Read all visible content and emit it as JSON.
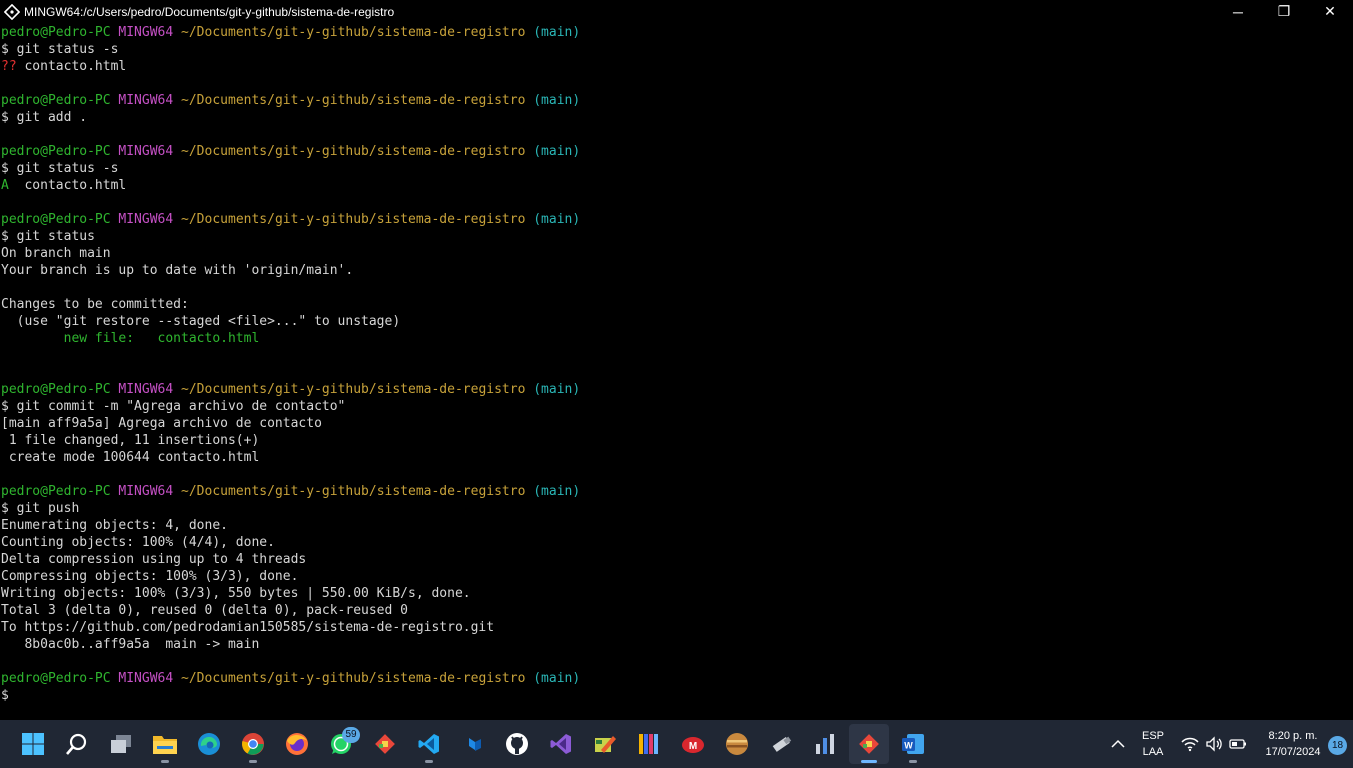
{
  "window": {
    "title": "MINGW64:/c/Users/pedro/Documents/git-y-github/sistema-de-registro",
    "minimize": "─",
    "restore": "❐",
    "close": "✕"
  },
  "prompt": {
    "user": "pedro@Pedro-PC",
    "sys": "MINGW64",
    "path": "~/Documents/git-y-github/sistema-de-registro",
    "branch": "(main)",
    "symbol": "$"
  },
  "terminal": {
    "lines": [
      {
        "type": "prompt"
      },
      {
        "type": "cmd",
        "text": "$ git status -s"
      },
      {
        "type": "status_untracked",
        "mark": "??",
        "text": " contacto.html"
      },
      {
        "type": "blank"
      },
      {
        "type": "prompt"
      },
      {
        "type": "cmd",
        "text": "$ git add ."
      },
      {
        "type": "blank"
      },
      {
        "type": "prompt"
      },
      {
        "type": "cmd",
        "text": "$ git status -s"
      },
      {
        "type": "status_added",
        "mark": "A",
        "text": "  contacto.html"
      },
      {
        "type": "blank"
      },
      {
        "type": "prompt"
      },
      {
        "type": "cmd",
        "text": "$ git status"
      },
      {
        "type": "out",
        "text": "On branch main"
      },
      {
        "type": "out",
        "text": "Your branch is up to date with 'origin/main'."
      },
      {
        "type": "blank"
      },
      {
        "type": "out",
        "text": "Changes to be committed:"
      },
      {
        "type": "out",
        "text": "  (use \"git restore --staged <file>...\" to unstage)"
      },
      {
        "type": "green",
        "text": "        new file:   contacto.html"
      },
      {
        "type": "blank"
      },
      {
        "type": "blank"
      },
      {
        "type": "prompt"
      },
      {
        "type": "cmd",
        "text": "$ git commit -m \"Agrega archivo de contacto\""
      },
      {
        "type": "out",
        "text": "[main aff9a5a] Agrega archivo de contacto"
      },
      {
        "type": "out",
        "text": " 1 file changed, 11 insertions(+)"
      },
      {
        "type": "out",
        "text": " create mode 100644 contacto.html"
      },
      {
        "type": "blank"
      },
      {
        "type": "prompt"
      },
      {
        "type": "cmd",
        "text": "$ git push"
      },
      {
        "type": "out",
        "text": "Enumerating objects: 4, done."
      },
      {
        "type": "out",
        "text": "Counting objects: 100% (4/4), done."
      },
      {
        "type": "out",
        "text": "Delta compression using up to 4 threads"
      },
      {
        "type": "out",
        "text": "Compressing objects: 100% (3/3), done."
      },
      {
        "type": "out",
        "text": "Writing objects: 100% (3/3), 550 bytes | 550.00 KiB/s, done."
      },
      {
        "type": "out",
        "text": "Total 3 (delta 0), reused 0 (delta 0), pack-reused 0"
      },
      {
        "type": "out",
        "text": "To https://github.com/pedrodamian150585/sistema-de-registro.git"
      },
      {
        "type": "out",
        "text": "   8b0ac0b..aff9a5a  main -> main"
      },
      {
        "type": "blank"
      },
      {
        "type": "prompt"
      },
      {
        "type": "cmd",
        "text": "$"
      }
    ]
  },
  "taskbar": {
    "apps": [
      {
        "name": "start-button",
        "icon": "windows-logo-icon"
      },
      {
        "name": "search-button",
        "icon": "search-icon"
      },
      {
        "name": "task-view-button",
        "icon": "task-view-icon"
      },
      {
        "name": "file-explorer",
        "icon": "folder-icon",
        "running": true
      },
      {
        "name": "edge",
        "icon": "edge-icon"
      },
      {
        "name": "chrome",
        "icon": "chrome-icon",
        "running": true
      },
      {
        "name": "firefox",
        "icon": "firefox-icon"
      },
      {
        "name": "whatsapp",
        "icon": "whatsapp-icon",
        "badge": "59"
      },
      {
        "name": "git-gui",
        "icon": "git-icon"
      },
      {
        "name": "vscode",
        "icon": "vscode-icon",
        "running": true
      },
      {
        "name": "vs-installer",
        "icon": "vs-installer-icon"
      },
      {
        "name": "github-desktop",
        "icon": "github-icon"
      },
      {
        "name": "visual-studio",
        "icon": "visual-studio-icon"
      },
      {
        "name": "draw-app",
        "icon": "pencil-paint-icon"
      },
      {
        "name": "books-app",
        "icon": "books-icon"
      },
      {
        "name": "mega",
        "icon": "mega-icon"
      },
      {
        "name": "game-app",
        "icon": "planet-icon"
      },
      {
        "name": "usb-app",
        "icon": "usb-drive-icon"
      },
      {
        "name": "stats-app",
        "icon": "bar-chart-icon"
      },
      {
        "name": "git-bash",
        "icon": "git-bash-icon",
        "running": true,
        "active": true
      },
      {
        "name": "word",
        "icon": "word-icon",
        "running": true
      }
    ],
    "lang_top": "ESP",
    "lang_bottom": "LAA",
    "time": "8:20 p. m.",
    "date": "17/07/2024",
    "notifications": "18"
  }
}
